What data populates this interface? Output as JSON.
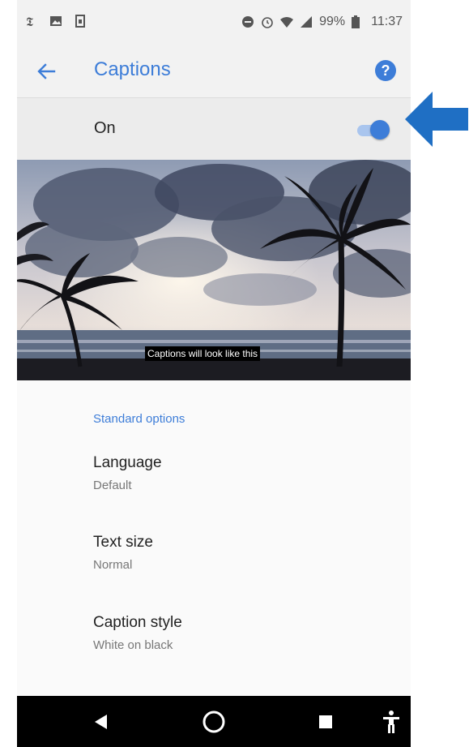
{
  "status_bar": {
    "left_icons": [
      "nyt-icon",
      "image-icon",
      "sim-card-icon"
    ],
    "right_icons": [
      "do-not-disturb-icon",
      "alarm-icon",
      "wifi-icon",
      "signal-icon"
    ],
    "battery": "99%",
    "time": "11:37"
  },
  "toolbar": {
    "title": "Captions",
    "back_icon": "arrow-left-icon",
    "help_icon": "help-icon",
    "help_glyph": "?"
  },
  "master_switch": {
    "label": "On",
    "state": "on"
  },
  "preview": {
    "caption_text": "Captions will look like this"
  },
  "options": {
    "section_title": "Standard options",
    "items": [
      {
        "title": "Language",
        "summary": "Default"
      },
      {
        "title": "Text size",
        "summary": "Normal"
      },
      {
        "title": "Caption style",
        "summary": "White on black"
      }
    ]
  },
  "nav_bar": {
    "buttons": [
      "back-triangle-icon",
      "home-circle-icon",
      "overview-square-icon",
      "accessibility-icon"
    ]
  },
  "colors": {
    "accent": "#3d7dd8",
    "toolbar_bg": "#f2f2f2",
    "switch_row_bg": "#ececec",
    "arrow": "#1f6fc4"
  }
}
